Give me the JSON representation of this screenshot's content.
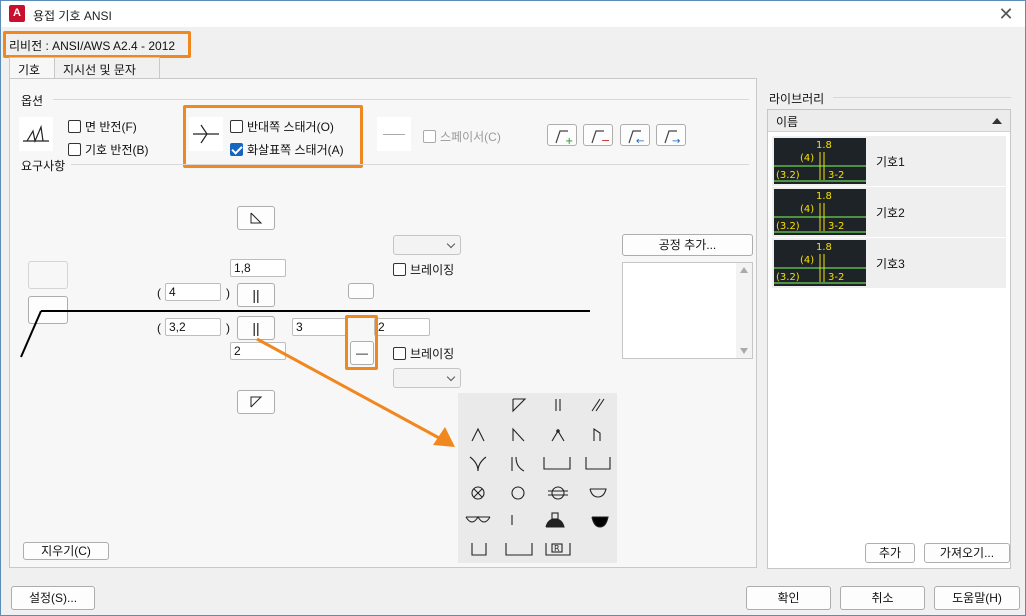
{
  "window": {
    "title": "용접 기호 ANSI",
    "app_icon": "A"
  },
  "revision": "리비전 : ANSI/AWS A2.4 - 2012",
  "tabs": [
    {
      "label": "기호"
    },
    {
      "label": "지시선 및 문자"
    }
  ],
  "options": {
    "title": "옵션",
    "flip_face": "면 반전(F)",
    "flip_symbol": "기호 반전(B)",
    "opposite_stagger": "반대쪽 스태거(O)",
    "arrow_stagger": "화살표쪽 스태거(A)",
    "spacer": "스페이서(C)"
  },
  "requirements": {
    "title": "요구사항",
    "other_side": {
      "paren_open": "(",
      "paren_close": ")",
      "size": "4",
      "top_value": "1,8"
    },
    "arrow_side": {
      "paren_open": "(",
      "paren_close": ")",
      "size": "3,2",
      "length": "3",
      "pitch": "2",
      "bottom_value": "2"
    },
    "brazing_top": "브레이징",
    "brazing_bottom": "브레이징",
    "add_process": "공정 추가..."
  },
  "clear_button": "지우기(C)",
  "library": {
    "title": "라이브러리",
    "header": "이름",
    "items": [
      {
        "label": "기호1",
        "top": "1.8",
        "mid": "(4)",
        "bottom": "(3.2)",
        "right": "3-2"
      },
      {
        "label": "기호2",
        "top": "1.8",
        "mid": "(4)",
        "bottom": "(3.2)",
        "right": "3-2"
      },
      {
        "label": "기호3",
        "top": "1.8",
        "mid": "(4)",
        "bottom": "(3.2)",
        "right": "3-2"
      }
    ],
    "add_button": "추가",
    "import_button": "가져오기..."
  },
  "footer": {
    "settings": "설정(S)...",
    "ok": "확인",
    "cancel": "취소",
    "help": "도움말(H)"
  },
  "colors": {
    "highlight": "#f0871f",
    "thumb_bg": "#1e2328",
    "thumb_fg": "#f5e000",
    "thumb_fg2": "#7fff5f",
    "checkbox_checked": "#1565c0"
  }
}
